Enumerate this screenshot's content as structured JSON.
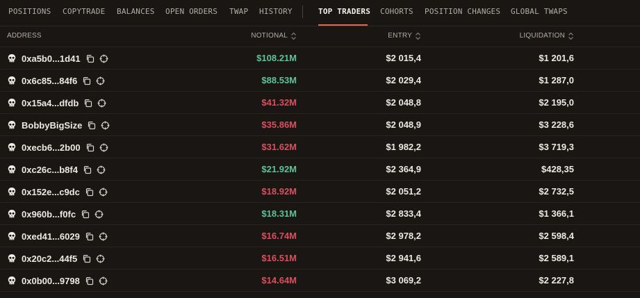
{
  "tabs": [
    {
      "label": "POSITIONS",
      "active": false
    },
    {
      "label": "COPYTRADE",
      "active": false
    },
    {
      "label": "BALANCES",
      "active": false
    },
    {
      "label": "OPEN ORDERS",
      "active": false
    },
    {
      "label": "TWAP",
      "active": false
    },
    {
      "label": "HISTORY",
      "active": false
    },
    {
      "label": "TOP TRADERS",
      "active": true
    },
    {
      "label": "COHORTS",
      "active": false
    },
    {
      "label": "POSITION CHANGES",
      "active": false
    },
    {
      "label": "GLOBAL TWAPS",
      "active": false
    }
  ],
  "table": {
    "columns": {
      "address": "ADDRESS",
      "notional": "NOTIONAL",
      "entry": "ENTRY",
      "liquidation": "LIQUIDATION"
    },
    "rows": [
      {
        "address": "0xa5b0...1d41",
        "notional": "$108.21M",
        "side": "long",
        "entry": "$2 015,4",
        "liquidation": "$1 201,6"
      },
      {
        "address": "0x6c85...84f6",
        "notional": "$88.53M",
        "side": "long",
        "entry": "$2 029,4",
        "liquidation": "$1 287,0"
      },
      {
        "address": "0x15a4...dfdb",
        "notional": "$41.32M",
        "side": "short",
        "entry": "$2 048,8",
        "liquidation": "$2 195,0"
      },
      {
        "address": "BobbyBigSize",
        "notional": "$35.86M",
        "side": "short",
        "entry": "$2 048,9",
        "liquidation": "$3 228,6"
      },
      {
        "address": "0xecb6...2b00",
        "notional": "$31.62M",
        "side": "short",
        "entry": "$1 982,2",
        "liquidation": "$3 719,3"
      },
      {
        "address": "0xc26c...b8f4",
        "notional": "$21.92M",
        "side": "long",
        "entry": "$2 364,9",
        "liquidation": "$428,35"
      },
      {
        "address": "0x152e...c9dc",
        "notional": "$18.92M",
        "side": "short",
        "entry": "$2 051,2",
        "liquidation": "$2 732,5"
      },
      {
        "address": "0x960b...f0fc",
        "notional": "$18.31M",
        "side": "long",
        "entry": "$2 833,4",
        "liquidation": "$1 366,1"
      },
      {
        "address": "0xed41...6029",
        "notional": "$16.74M",
        "side": "short",
        "entry": "$2 978,2",
        "liquidation": "$2 598,4"
      },
      {
        "address": "0x20c2...44f5",
        "notional": "$16.51M",
        "side": "short",
        "entry": "$2 941,6",
        "liquidation": "$2 589,1"
      },
      {
        "address": "0x0b00...9798",
        "notional": "$14.64M",
        "side": "short",
        "entry": "$3 069,2",
        "liquidation": "$2 227,8"
      }
    ]
  },
  "icons": {
    "avatar": "skull-icon",
    "copy": "copy-icon",
    "track": "crosshair-icon",
    "sort": "sort-icon"
  },
  "colors": {
    "background": "#191614",
    "long": "#5fc296",
    "short": "#d9505c",
    "accent": "#e8674a"
  }
}
